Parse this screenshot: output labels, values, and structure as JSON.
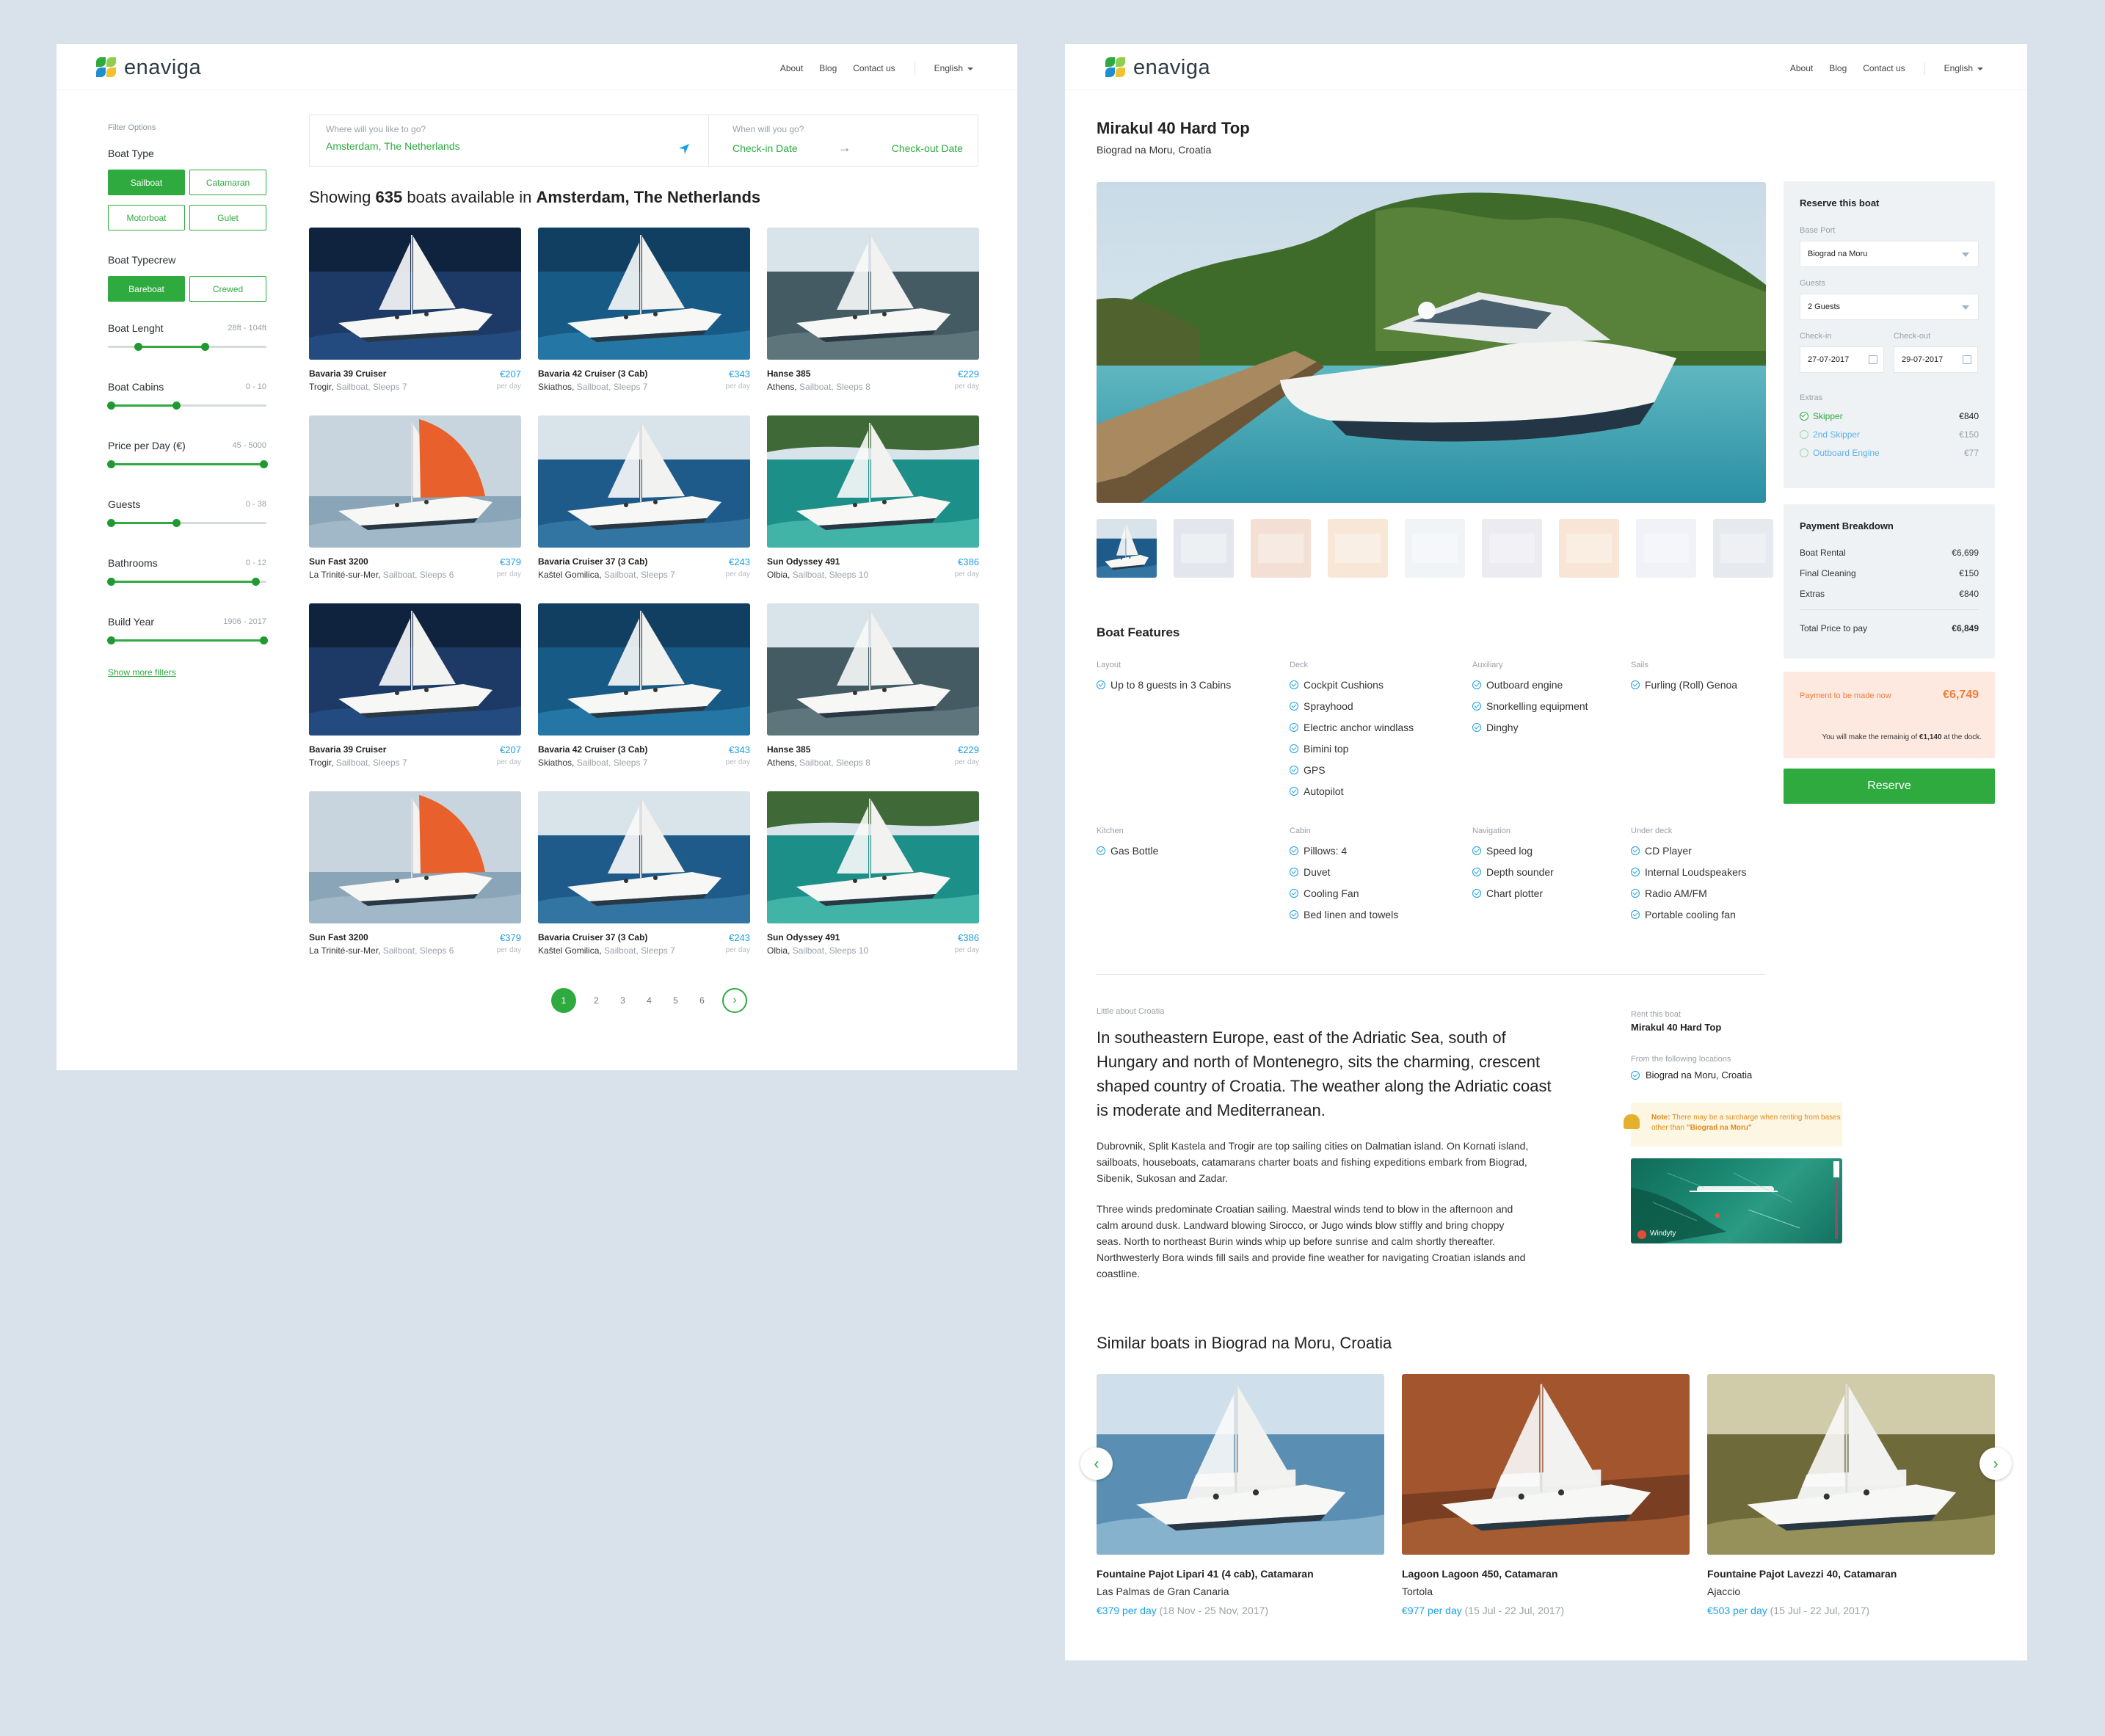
{
  "brand": {
    "name": "enaviga"
  },
  "nav": {
    "about": "About",
    "blog": "Blog",
    "contact": "Contact us",
    "language": "English"
  },
  "search": {
    "where_label": "Where will you like to go?",
    "where_value": "Amsterdam, The Netherlands",
    "when_label": "When will you go?",
    "checkin_placeholder": "Check-in Date",
    "checkout_placeholder": "Check-out Date"
  },
  "filters": {
    "title": "Filter Options",
    "boat_type": {
      "label": "Boat Type",
      "options": [
        "Sailboat",
        "Catamaran",
        "Motorboat",
        "Gulet"
      ],
      "selected": "Sailboat"
    },
    "boat_typecrew": {
      "label": "Boat Typecrew",
      "options": [
        "Bareboat",
        "Crewed"
      ],
      "selected": "Bareboat"
    },
    "sliders": [
      {
        "label": "Boat Lenght",
        "range": "28ft - 104ft",
        "lo": 0.19,
        "hi": 0.61
      },
      {
        "label": "Boat Cabins",
        "range": "0 - 10",
        "lo": 0.02,
        "hi": 0.43
      },
      {
        "label": "Price per Day (€)",
        "range": "45 - 5000",
        "lo": 0.02,
        "hi": 0.98
      },
      {
        "label": "Guests",
        "range": "0 - 38",
        "lo": 0.02,
        "hi": 0.43
      },
      {
        "label": "Bathrooms",
        "range": "0 - 12",
        "lo": 0.02,
        "hi": 0.93
      },
      {
        "label": "Build Year",
        "range": "1906 - 2017",
        "lo": 0.02,
        "hi": 0.98
      }
    ],
    "show_more": "Show more filters"
  },
  "results": {
    "prefix": "Showing",
    "count": "635",
    "middle": "boats available in",
    "place": "Amsterdam, The Netherlands",
    "per_day": "per day",
    "boats": [
      {
        "name": "Bavaria 39 Cruiser",
        "loc": "Trogir,",
        "detail": "Sailboat, Sleeps 7",
        "price": "€207",
        "img": "b1"
      },
      {
        "name": "Bavaria 42 Cruiser (3 Cab)",
        "loc": "Skiathos,",
        "detail": "Sailboat, Sleeps 7",
        "price": "€343",
        "img": "b2"
      },
      {
        "name": "Hanse 385",
        "loc": "Athens,",
        "detail": "Sailboat, Sleeps 8",
        "price": "€229",
        "img": "b3"
      },
      {
        "name": "Sun Fast 3200",
        "loc": "La Trinité-sur-Mer,",
        "detail": "Sailboat, Sleeps 6",
        "price": "€379",
        "img": "b4"
      },
      {
        "name": "Bavaria Cruiser 37 (3 Cab)",
        "loc": "Kaštel Gomilica,",
        "detail": "Sailboat, Sleeps 7",
        "price": "€243",
        "img": "b5"
      },
      {
        "name": "Sun Odyssey 491",
        "loc": "Olbia,",
        "detail": "Sailboat, Sleeps 10",
        "price": "€386",
        "img": "b6"
      },
      {
        "name": "Bavaria 39 Cruiser",
        "loc": "Trogir,",
        "detail": "Sailboat, Sleeps 7",
        "price": "€207",
        "img": "b1"
      },
      {
        "name": "Bavaria 42 Cruiser (3 Cab)",
        "loc": "Skiathos,",
        "detail": "Sailboat, Sleeps 7",
        "price": "€343",
        "img": "b2"
      },
      {
        "name": "Hanse 385",
        "loc": "Athens,",
        "detail": "Sailboat, Sleeps 8",
        "price": "€229",
        "img": "b3"
      },
      {
        "name": "Sun Fast 3200",
        "loc": "La Trinité-sur-Mer,",
        "detail": "Sailboat, Sleeps 6",
        "price": "€379",
        "img": "b4"
      },
      {
        "name": "Bavaria Cruiser 37 (3 Cab)",
        "loc": "Kaštel Gomilica,",
        "detail": "Sailboat, Sleeps 7",
        "price": "€243",
        "img": "b5"
      },
      {
        "name": "Sun Odyssey 491",
        "loc": "Olbia,",
        "detail": "Sailboat, Sleeps 10",
        "price": "€386",
        "img": "b6"
      }
    ],
    "pages": [
      "1",
      "2",
      "3",
      "4",
      "5",
      "6"
    ],
    "current_page": "1"
  },
  "detail": {
    "title": "Mirakul 40 Hard Top",
    "location": "Biograd na Moru, Croatia",
    "features_title": "Boat Features",
    "features": [
      {
        "head": "Layout",
        "items": [
          "Up to 8 guests in 3 Cabins"
        ]
      },
      {
        "head": "Deck",
        "items": [
          "Cockpit Cushions",
          "Sprayhood",
          "Electric anchor windlass",
          "Bimini top",
          "GPS",
          "Autopilot"
        ]
      },
      {
        "head": "Auxiliary",
        "items": [
          "Outboard engine",
          "Snorkelling equipment",
          "Dinghy"
        ]
      },
      {
        "head": "Sails",
        "items": [
          "Furling (Roll) Genoa"
        ]
      },
      {
        "head": "Kitchen",
        "items": [
          "Gas Bottle"
        ]
      },
      {
        "head": "Cabin",
        "items": [
          "Pillows: 4",
          "Duvet",
          "Cooling Fan",
          "Bed linen and towels"
        ]
      },
      {
        "head": "Navigation",
        "items": [
          "Speed log",
          "Depth sounder",
          "Chart plotter"
        ]
      },
      {
        "head": "Under deck",
        "items": [
          "CD Player",
          "Internal Loudspeakers",
          "Radio AM/FM",
          "Portable cooling fan"
        ]
      }
    ],
    "about_caption": "Little about Croatia",
    "about_lead": "In southeastern Europe, east of the Adriatic Sea, south of Hungary and north of Montenegro, sits the charming, crescent shaped country of Croatia. The weather along the Adriatic coast is moderate and Mediterranean.",
    "about_p1": "Dubrovnik, Split Kastela and Trogir are top sailing cities on Dalmatian island. On Kornati island, sailboats, houseboats, catamarans charter boats and fishing expeditions embark from Biograd, Sibenik, Sukosan and Zadar.",
    "about_p2": "Three winds predominate Croatian sailing. Maestral winds tend to blow in the afternoon and calm around dusk. Landward blowing Sirocco, or Jugo winds blow stiffly and bring choppy seas. North to northeast Burin winds whip up before sunrise and calm shortly thereafter. Northwesterly Bora winds fill sails and provide fine weather for navigating Croatian islands and coastline.",
    "rent_caption": "Rent this boat",
    "rent_name": "Mirakul 40 Hard Top",
    "from_caption": "From the following locations",
    "from_location": "Biograd na Moru, Croatia",
    "note_prefix": "Note:",
    "note_text": "There may be a surcharge when renting from bases other than",
    "note_place": "\"Biograd na Moru\"",
    "map_brand": "Windyty",
    "similar_title": "Similar boats in Biograd na Moru, Croatia",
    "similar": [
      {
        "name": "Fountaine Pajot Lipari 41 (4 cab), Catamaran",
        "loc": "Las Palmas de Gran Canaria",
        "price": "€379 per day",
        "dates": "(18 Nov - 25 Nov, 2017)",
        "img": "s1"
      },
      {
        "name": "Lagoon Lagoon 450, Catamaran",
        "loc": "Tortola",
        "price": "€977 per day",
        "dates": "(15 Jul - 22 Jul, 2017)",
        "img": "s2"
      },
      {
        "name": "Fountaine Pajot Lavezzi 40, Catamaran",
        "loc": "Ajaccio",
        "price": "€503 per day",
        "dates": "(15 Jul - 22 Jul, 2017)",
        "img": "s3"
      }
    ]
  },
  "reserve": {
    "title": "Reserve this boat",
    "base_port_label": "Base Port",
    "base_port": "Biograd na Moru",
    "guests_label": "Guests",
    "guests": "2 Guests",
    "checkin_label": "Check-in",
    "checkin": "27-07-2017",
    "checkout_label": "Check-out",
    "checkout": "29-07-2017",
    "extras_label": "Extras",
    "extras": [
      {
        "name": "Skipper",
        "price": "€840",
        "on": true
      },
      {
        "name": "2nd Skipper",
        "price": "€150",
        "on": false
      },
      {
        "name": "Outboard Engine",
        "price": "€77",
        "on": false
      }
    ],
    "breakdown_title": "Payment Breakdown",
    "breakdown": [
      {
        "label": "Boat Rental",
        "value": "€6,699"
      },
      {
        "label": "Final Cleaning",
        "value": "€150"
      },
      {
        "label": "Extras",
        "value": "€840"
      }
    ],
    "total_label": "Total Price to pay",
    "total": "€6,849",
    "pay_now_label": "Payment to be made now",
    "pay_now": "€6,749",
    "remain_prefix": "You will make the remainig of",
    "remain": "€1,140",
    "remain_suffix": "at the dock.",
    "button": "Reserve"
  },
  "colors": {
    "accent": "#2eaa3f",
    "link": "#1ba0e2",
    "background": "#d9e2ea"
  }
}
